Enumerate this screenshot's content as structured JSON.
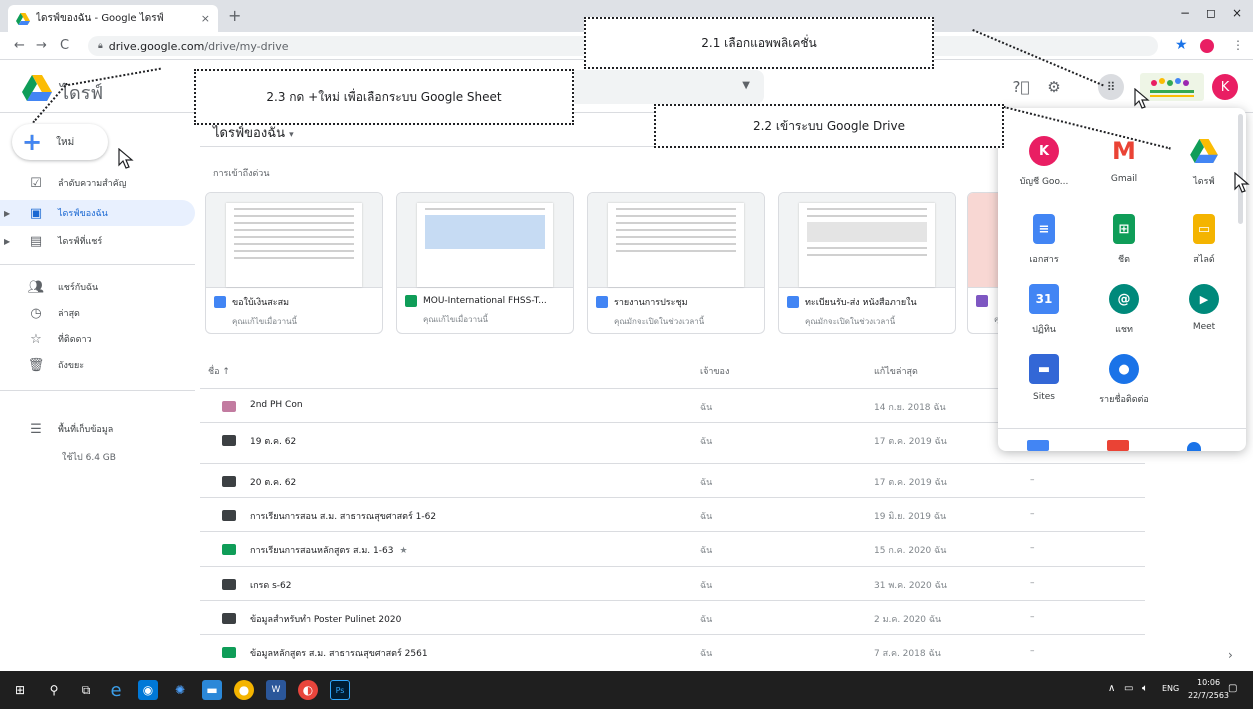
{
  "browser": {
    "tab_title": "ไดรฟ์ของฉัน - Google ไดรฟ์",
    "tab_close": "×",
    "new_tab": "+",
    "url_host": "drive.google.com",
    "url_path": "/drive/my-drive",
    "win_minimize": "−",
    "win_restore": "◻",
    "win_close": "×",
    "profile_color": "#e91e63"
  },
  "header": {
    "brand": "ไดรฟ์",
    "help_icon": "help-icon",
    "settings_icon": "gear-icon",
    "avatar_letter": "K"
  },
  "sidebar": {
    "new_label": "ใหม่",
    "items": [
      {
        "label": "ลำดับความสำคัญ",
        "icon": "priority-icon",
        "active": false
      },
      {
        "label": "ไดรฟ์ของฉัน",
        "icon": "my-drive-icon",
        "active": true
      },
      {
        "label": "ไดรฟ์ที่แชร์",
        "icon": "shared-drives-icon",
        "active": false
      },
      {
        "label": "แชร์กับฉัน",
        "icon": "shared-with-me-icon",
        "active": false
      },
      {
        "label": "ล่าสุด",
        "icon": "clock-icon",
        "active": false
      },
      {
        "label": "ที่ติดดาว",
        "icon": "star-icon",
        "active": false
      },
      {
        "label": "ถังขยะ",
        "icon": "trash-icon",
        "active": false
      },
      {
        "label": "พื้นที่เก็บข้อมูล",
        "icon": "storage-icon",
        "active": false
      }
    ],
    "quota": "ใช้ไป 6.4 GB"
  },
  "main": {
    "title": "ไดรฟ์ของฉัน",
    "quick_access": "การเข้าถึงด่วน",
    "cards": [
      {
        "name": "ขอใบ้เงินสะสม",
        "sub": "คุณแก้ไขเมื่อวานนี้",
        "icon_color": "#4285f4"
      },
      {
        "name": "MOU-International FHSS-T...",
        "sub": "คุณแก้ไขเมื่อวานนี้",
        "icon_color": "#0f9d58"
      },
      {
        "name": "รายงานการประชุม",
        "sub": "คุณมักจะเปิดในช่วงเวลานี้",
        "icon_color": "#4285f4"
      },
      {
        "name": "ทะเบียนรับ-ส่ง หนังสือภายใน",
        "sub": "คุณมักจะเปิดในช่วงเวลานี้",
        "icon_color": "#4285f4"
      },
      {
        "name": "",
        "sub": "คุณ",
        "icon_color": "#7e57c2"
      }
    ],
    "columns": {
      "name": "ชื่อ ↑",
      "owner": "เจ้าของ",
      "modified": "แก้ไขล่าสุด"
    },
    "files": [
      {
        "name": "2nd PH Con",
        "owner": "ฉัน",
        "modified": "14 ก.ย. 2018 ฉัน",
        "size": "",
        "color": "#c27ba0",
        "starred": false
      },
      {
        "name": "19 ต.ค. 62",
        "owner": "ฉัน",
        "modified": "17 ต.ค. 2019 ฉัน",
        "size": "",
        "color": "#3c4043",
        "starred": false
      },
      {
        "name": "20 ต.ค. 62",
        "owner": "ฉัน",
        "modified": "17 ต.ค. 2019 ฉัน",
        "size": "–",
        "color": "#3c4043",
        "starred": false
      },
      {
        "name": "การเรียนการสอน ส.ม. สาธารณสุขศาสตร์ 1-62",
        "owner": "ฉัน",
        "modified": "19 มิ.ย. 2019 ฉัน",
        "size": "–",
        "color": "#3c4043",
        "starred": false
      },
      {
        "name": "การเรียนการสอนหลักสูตร ส.ม. 1-63",
        "owner": "ฉัน",
        "modified": "15 ก.ค. 2020 ฉัน",
        "size": "–",
        "color": "#0f9d58",
        "starred": true
      },
      {
        "name": "เกรด s-62",
        "owner": "ฉัน",
        "modified": "31 พ.ค. 2020 ฉัน",
        "size": "–",
        "color": "#3c4043",
        "starred": false
      },
      {
        "name": "ข้อมูลสำหรับทำ Poster Pulinet 2020",
        "owner": "ฉัน",
        "modified": "2 ม.ค. 2020 ฉัน",
        "size": "–",
        "color": "#3c4043",
        "starred": false
      },
      {
        "name": "ข้อมูลหลักสูตร ส.ม. สาธารณสุขศาสตร์ 2561",
        "owner": "ฉัน",
        "modified": "7 ส.ค. 2018 ฉัน",
        "size": "–",
        "color": "#0f9d58",
        "starred": false
      }
    ]
  },
  "apps_panel": {
    "apps": [
      {
        "name": "บัญชี Goo...",
        "glyph": "K",
        "color": "#e91e63"
      },
      {
        "name": "Gmail",
        "glyph": "M",
        "color": "#ea4335"
      },
      {
        "name": "ไดรฟ์",
        "glyph": "▲",
        "color": "#0f9d58"
      },
      {
        "name": "เอกสาร",
        "glyph": "≡",
        "color": "#4285f4"
      },
      {
        "name": "ชีต",
        "glyph": "⊞",
        "color": "#0f9d58"
      },
      {
        "name": "สไลด์",
        "glyph": "▭",
        "color": "#f4b400"
      },
      {
        "name": "ปฏิทิน",
        "glyph": "31",
        "color": "#4285f4"
      },
      {
        "name": "แชท",
        "glyph": "@",
        "color": "#00897b"
      },
      {
        "name": "Meet",
        "glyph": "▶",
        "color": "#00897b"
      },
      {
        "name": "Sites",
        "glyph": "▬",
        "color": "#3367d6"
      },
      {
        "name": "รายชื่อติดต่อ",
        "glyph": "●",
        "color": "#1a73e8"
      }
    ]
  },
  "callouts": {
    "c21": "2.1 เลือกแอพพลิเคชั่น",
    "c22": "2.2 เข้าระบบ Google Drive",
    "c23": "2.3 กด +ใหม่ เพื่อเลือกระบบ Google Sheet"
  },
  "taskbar": {
    "lang": "ENG",
    "time": "10:06",
    "date": "22/7/2563"
  }
}
